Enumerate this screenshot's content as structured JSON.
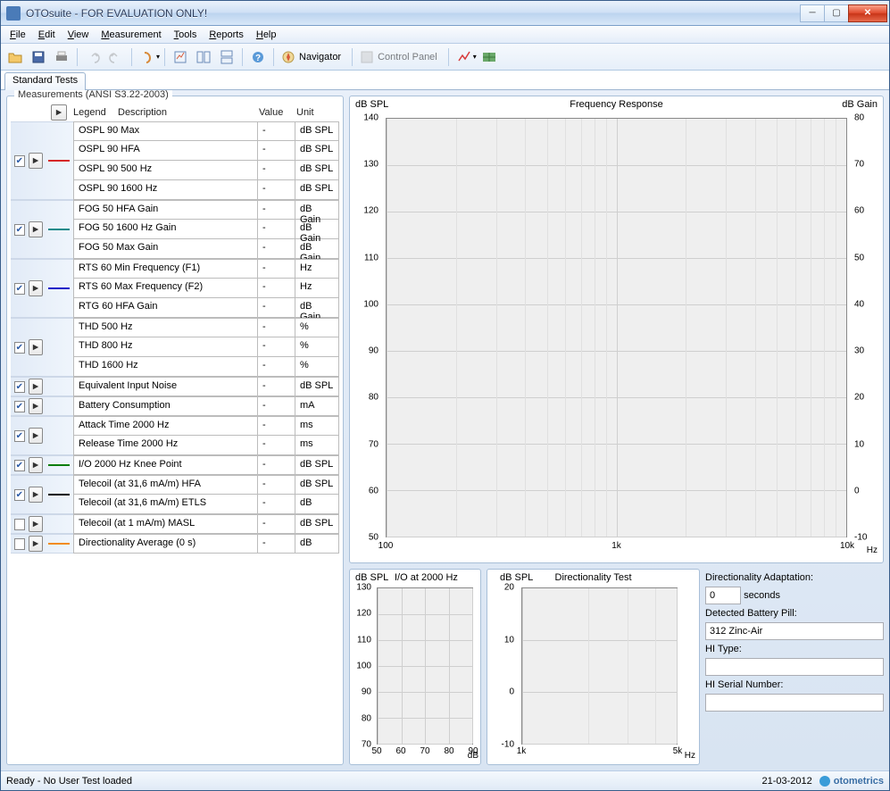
{
  "window": {
    "title": "OTOsuite - FOR EVALUATION ONLY!"
  },
  "menu": [
    "File",
    "Edit",
    "View",
    "Measurement",
    "Tools",
    "Reports",
    "Help"
  ],
  "toolbar": {
    "navigator": "Navigator",
    "control_panel": "Control Panel"
  },
  "tab": "Standard Tests",
  "panel": {
    "title": "Measurements (ANSI S3.22-2003)",
    "headers": {
      "legend": "Legend",
      "desc": "Description",
      "value": "Value",
      "unit": "Unit"
    }
  },
  "groups": [
    {
      "checked": true,
      "legend": "#d62728",
      "rows": [
        {
          "desc": "OSPL 90 Max",
          "val": "-",
          "unit": "dB SPL"
        },
        {
          "desc": "OSPL 90 HFA",
          "val": "-",
          "unit": "dB SPL"
        },
        {
          "desc": "OSPL 90 500 Hz",
          "val": "-",
          "unit": "dB SPL"
        },
        {
          "desc": "OSPL 90 1600 Hz",
          "val": "-",
          "unit": "dB SPL"
        }
      ]
    },
    {
      "checked": true,
      "legend": "#138a8a",
      "rows": [
        {
          "desc": "FOG 50 HFA Gain",
          "val": "-",
          "unit": "dB Gain"
        },
        {
          "desc": "FOG 50 1600 Hz Gain",
          "val": "-",
          "unit": "dB Gain"
        },
        {
          "desc": "FOG 50 Max Gain",
          "val": "-",
          "unit": "dB Gain"
        }
      ]
    },
    {
      "checked": true,
      "legend": "#1818c8",
      "rows": [
        {
          "desc": "RTS 60 Min Frequency (F1)",
          "val": "-",
          "unit": "Hz"
        },
        {
          "desc": "RTS 60 Max Frequency (F2)",
          "val": "-",
          "unit": "Hz"
        },
        {
          "desc": "RTG 60 HFA Gain",
          "val": "-",
          "unit": "dB Gain"
        }
      ]
    },
    {
      "checked": true,
      "legend": "",
      "rows": [
        {
          "desc": "THD 500 Hz",
          "val": "-",
          "unit": "%"
        },
        {
          "desc": "THD 800 Hz",
          "val": "-",
          "unit": "%"
        },
        {
          "desc": "THD 1600 Hz",
          "val": "-",
          "unit": "%"
        }
      ]
    },
    {
      "checked": true,
      "legend": "",
      "rows": [
        {
          "desc": "Equivalent Input Noise",
          "val": "-",
          "unit": "dB SPL"
        }
      ]
    },
    {
      "checked": true,
      "legend": "",
      "rows": [
        {
          "desc": "Battery Consumption",
          "val": "-",
          "unit": "mA"
        }
      ]
    },
    {
      "checked": true,
      "legend": "",
      "rows": [
        {
          "desc": "Attack Time 2000 Hz",
          "val": "-",
          "unit": "ms"
        },
        {
          "desc": "Release Time 2000 Hz",
          "val": "-",
          "unit": "ms"
        }
      ]
    },
    {
      "checked": true,
      "legend": "#0a7d0a",
      "rows": [
        {
          "desc": "I/O 2000 Hz Knee Point",
          "val": "-",
          "unit": "dB SPL"
        }
      ]
    },
    {
      "checked": true,
      "legend": "#000000",
      "rows": [
        {
          "desc": "Telecoil (at 31,6 mA/m) HFA",
          "val": "-",
          "unit": "dB SPL"
        },
        {
          "desc": "Telecoil (at 31,6 mA/m) ETLS",
          "val": "-",
          "unit": "dB"
        }
      ]
    },
    {
      "checked": false,
      "legend": "",
      "rows": [
        {
          "desc": "Telecoil (at 1 mA/m) MASL",
          "val": "-",
          "unit": "dB SPL"
        }
      ]
    },
    {
      "checked": false,
      "legend": "#f28c1c",
      "rows": [
        {
          "desc": "Directionality Average (0 s)",
          "val": "-",
          "unit": "dB"
        }
      ]
    }
  ],
  "chart_main": {
    "title": "Frequency Response",
    "ylabel_l": "dB SPL",
    "ylabel_r": "dB Gain",
    "yticks_l": [
      140,
      130,
      120,
      110,
      100,
      90,
      80,
      70,
      60,
      50
    ],
    "yticks_r": [
      80,
      70,
      60,
      50,
      40,
      30,
      20,
      10,
      0,
      -10
    ],
    "xticks": [
      {
        "v": "100",
        "p": 0
      },
      {
        "v": "1k",
        "p": 50
      },
      {
        "v": "10k",
        "p": 100
      }
    ],
    "xunit": "Hz"
  },
  "chart_io": {
    "label": "dB SPL",
    "title": "I/O at 2000 Hz",
    "yticks": [
      130,
      120,
      110,
      100,
      90,
      80,
      70
    ],
    "xticks": [
      50,
      60,
      70,
      80,
      90
    ],
    "xunit": "dB"
  },
  "chart_dir": {
    "label": "dB SPL",
    "title": "Directionality Test",
    "yticks": [
      20,
      10,
      0,
      -10
    ],
    "xticks": [
      {
        "v": "1k",
        "p": 0
      },
      {
        "v": "5k",
        "p": 100
      }
    ],
    "xunit": "Hz"
  },
  "info": {
    "adapt_label": "Directionality Adaptation:",
    "adapt_value": "0",
    "adapt_unit": "seconds",
    "battery_label": "Detected Battery Pill:",
    "battery_value": "312 Zinc-Air",
    "hitype_label": "HI Type:",
    "hitype_value": "",
    "serial_label": "HI Serial Number:",
    "serial_value": ""
  },
  "status": {
    "text": "Ready - No User Test loaded",
    "date": "21-03-2012",
    "brand": "otometrics"
  },
  "chart_data": [
    {
      "type": "line",
      "title": "Frequency Response",
      "xlabel": "Hz",
      "ylabel": "dB SPL",
      "ylabel2": "dB Gain",
      "xlim": [
        100,
        10000
      ],
      "xscale": "log",
      "ylim": [
        50,
        140
      ],
      "ylim2": [
        -10,
        80
      ],
      "series": []
    },
    {
      "type": "line",
      "title": "I/O at 2000 Hz",
      "xlabel": "dB",
      "ylabel": "dB SPL",
      "xlim": [
        50,
        90
      ],
      "ylim": [
        70,
        130
      ],
      "series": []
    },
    {
      "type": "line",
      "title": "Directionality Test",
      "xlabel": "Hz",
      "ylabel": "dB SPL",
      "xlim": [
        1000,
        5000
      ],
      "xscale": "log",
      "ylim": [
        -10,
        20
      ],
      "series": []
    }
  ]
}
